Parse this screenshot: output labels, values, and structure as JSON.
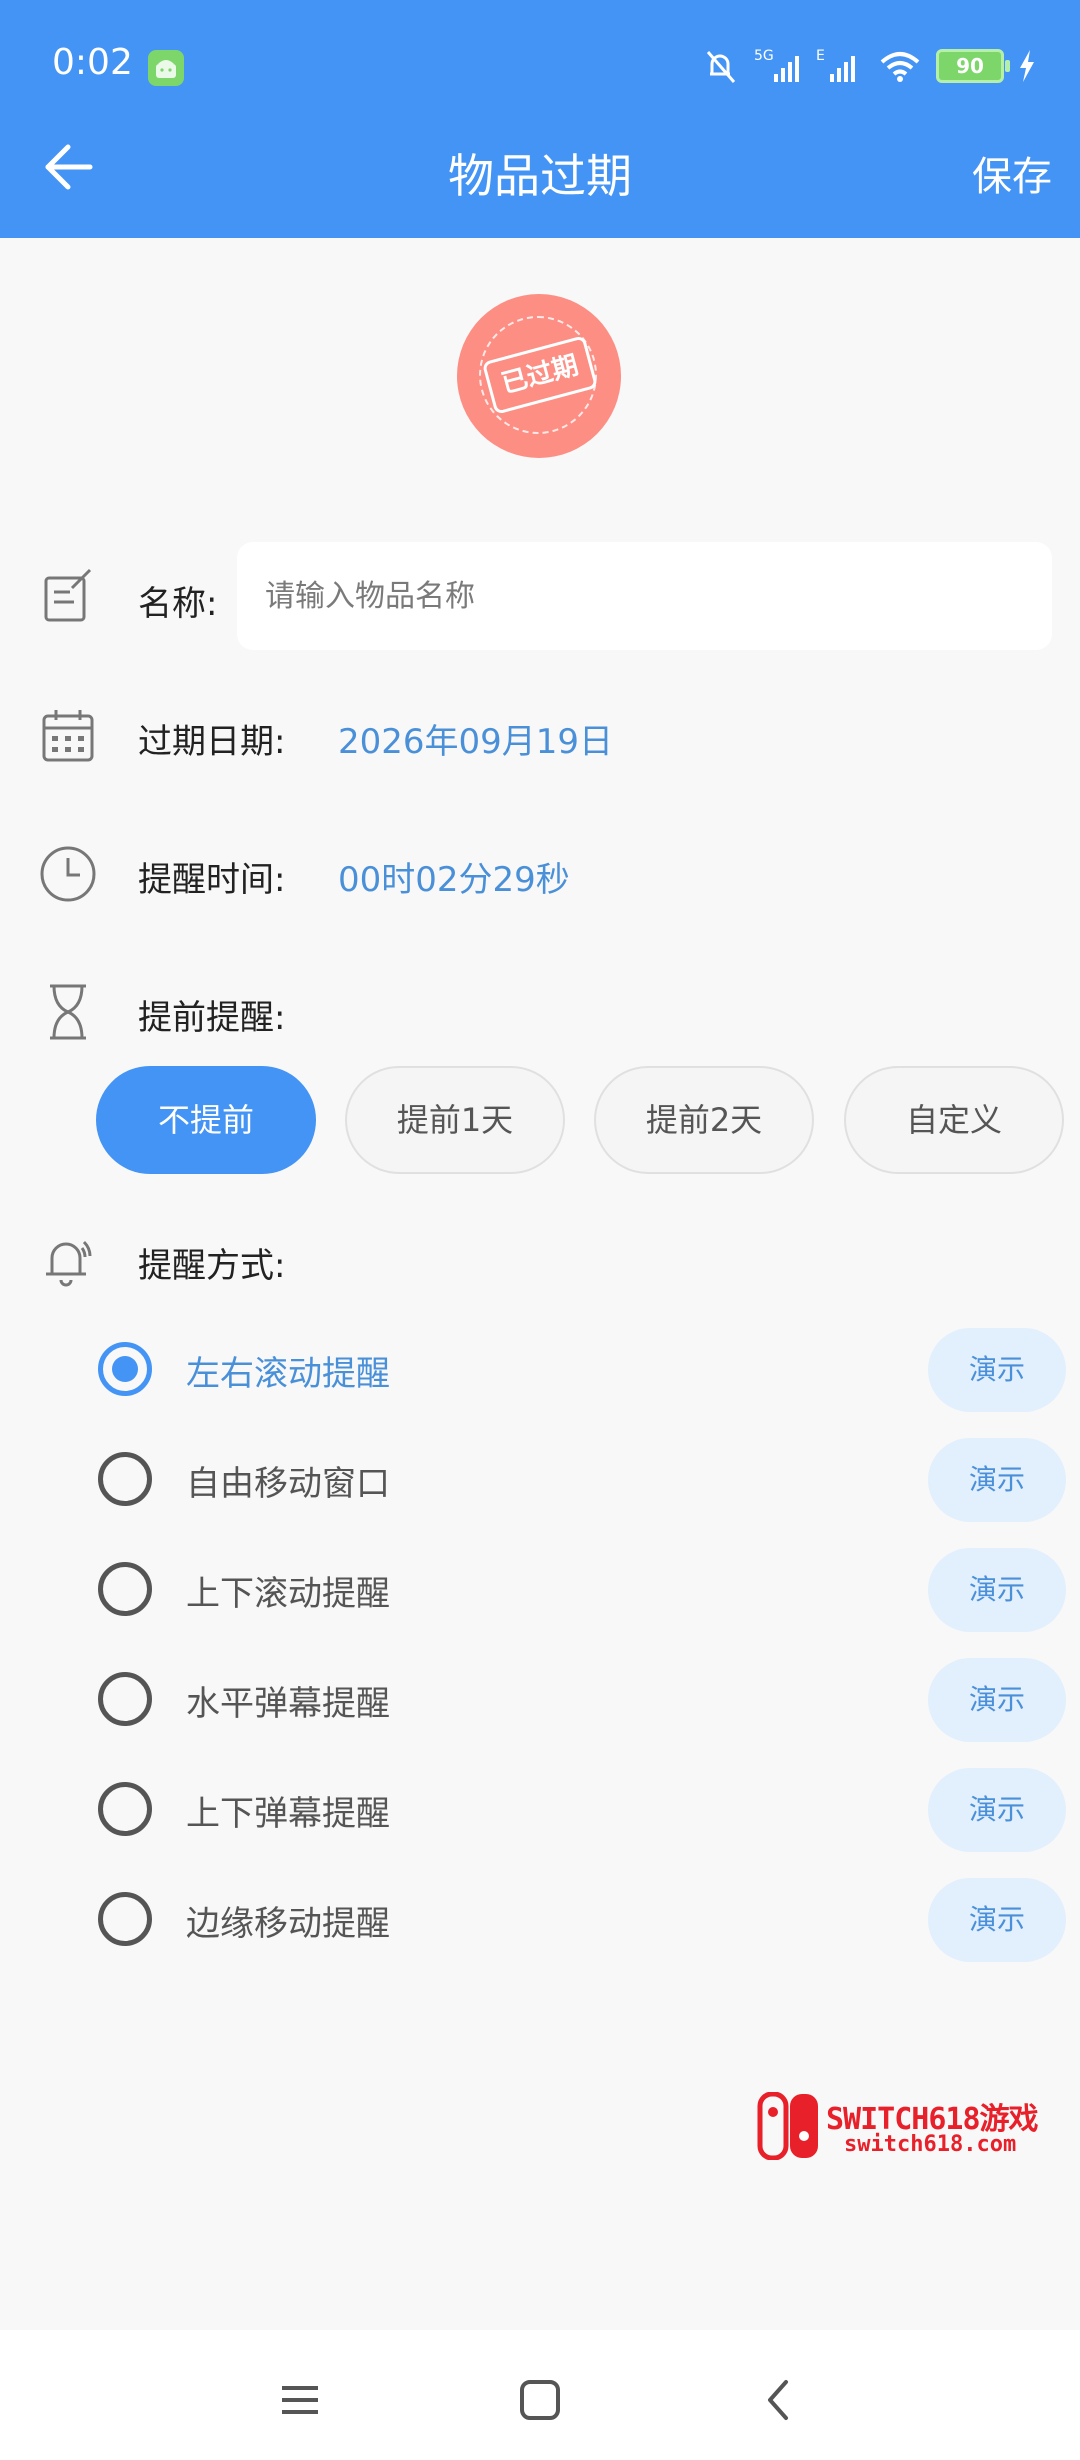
{
  "status_bar": {
    "time": "0:02",
    "battery": "90",
    "network": "5G",
    "network2": "E",
    "icons": [
      "android-icon",
      "mute-icon",
      "signal-icon",
      "wifi-icon",
      "battery-icon",
      "charging-icon"
    ]
  },
  "header": {
    "title": "物品过期",
    "save_label": "保存",
    "back_icon": "back-arrow-icon"
  },
  "badge": {
    "text": "已过期",
    "color": "#fd8e84"
  },
  "form": {
    "name_label": "名称:",
    "name_placeholder": "请输入物品名称",
    "name_value": "",
    "date_label": "过期日期:",
    "date_value": "2026年09月19日",
    "time_label": "提醒时间:",
    "time_value": "00时02分29秒",
    "advance_label": "提前提醒:",
    "advance_options": [
      "不提前",
      "提前1天",
      "提前2天",
      "自定义"
    ],
    "advance_selected": "不提前",
    "method_label": "提醒方式:",
    "methods": [
      "左右滚动提醒",
      "自由移动窗口",
      "上下滚动提醒",
      "水平弹幕提醒",
      "上下弹幕提醒",
      "边缘移动提醒"
    ],
    "method_selected": "左右滚动提醒",
    "demo_label": "演示"
  },
  "watermark": {
    "title": "SWITCH618游戏",
    "url": "switch618.com"
  },
  "colors": {
    "accent": "#4394f5",
    "value_text": "#4a90d9",
    "badge": "#fd8e84",
    "watermark": "#e8202a"
  },
  "navbar": {
    "icons": [
      "menu-icon",
      "home-square-icon",
      "back-chevron-icon"
    ]
  }
}
